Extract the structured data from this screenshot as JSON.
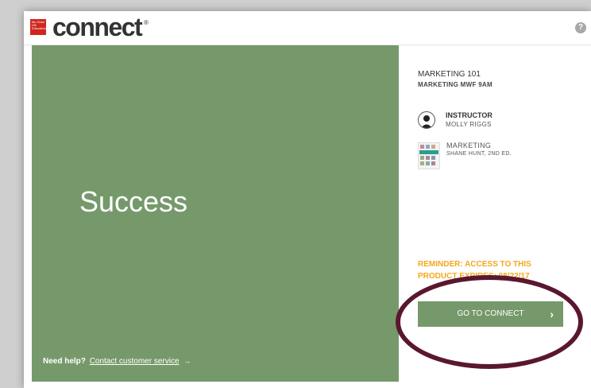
{
  "header": {
    "logo_badge": "Mc Graw Hill Education",
    "logo_text": "connect",
    "logo_reg": "®",
    "help_glyph": "?"
  },
  "main": {
    "success_text": "Success",
    "help_prefix": "Need help?",
    "help_link": "Contact customer service",
    "help_arrow": "→"
  },
  "course": {
    "title": "MARKETING 101",
    "section": "MARKETING MWF 9AM"
  },
  "instructor": {
    "label": "INSTRUCTOR",
    "name": "MOLLY RIGGS"
  },
  "book": {
    "title": "MARKETING",
    "author": "SHANE HUNT, 2ND ED."
  },
  "reminder": {
    "line1": "REMINDER: ACCESS TO THIS",
    "line2": "PRODUCT EXPIRES: 08/22/17"
  },
  "action": {
    "go_label": "GO TO CONNECT",
    "chevron": "›"
  },
  "colors": {
    "brand_green": "#76996b",
    "reminder_orange": "#f2a81f",
    "logo_red": "#d0261e",
    "annotation": "#5a1730"
  },
  "icons": [
    "help-icon",
    "user-avatar-icon",
    "book-cover-icon",
    "chevron-right-icon",
    "arrow-right-icon"
  ]
}
